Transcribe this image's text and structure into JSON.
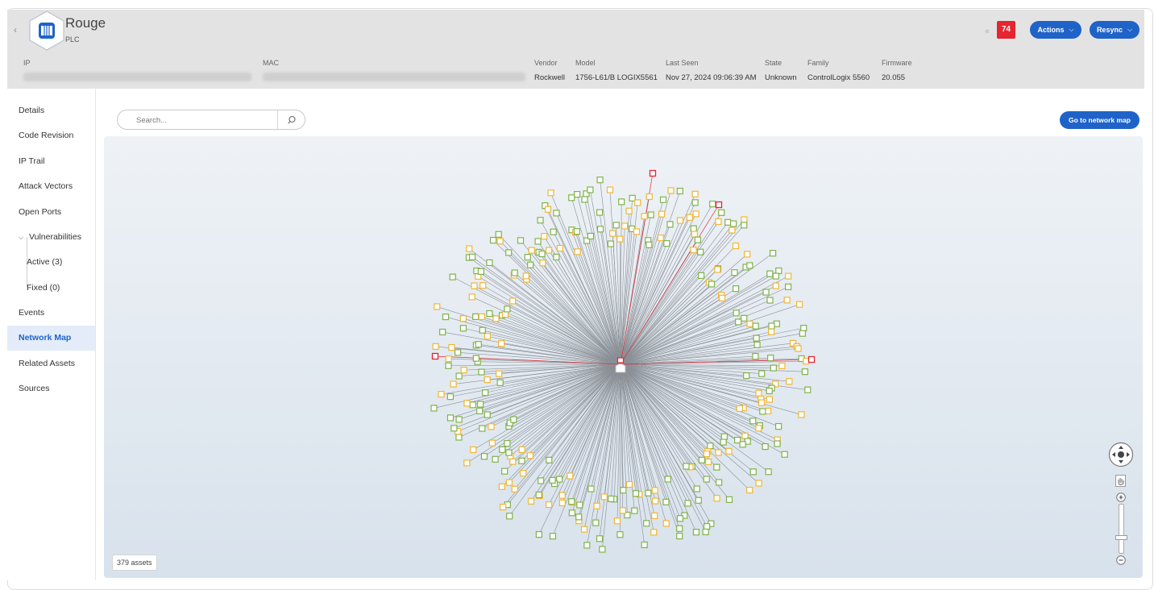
{
  "header": {
    "asset_name": "Rouge",
    "asset_type": "PLC",
    "icons": {
      "back": "chevron-left-icon",
      "asset": "plc-icon",
      "collapse": "double-chevron-left-icon"
    },
    "risk_score": "74",
    "risk_color": "#e5252f",
    "actions_label": "Actions",
    "resync_label": "Resync",
    "accent_color": "#1f63c9"
  },
  "meta": {
    "ip_label": "IP",
    "mac_label": "MAC",
    "vendor_label": "Vendor",
    "vendor_value": "Rockwell",
    "model_label": "Model",
    "model_value": "1756-L61/B LOGIX5561",
    "last_seen_label": "Last Seen",
    "last_seen_value": "Nov 27, 2024 09:06:39 AM",
    "state_label": "State",
    "state_value": "Unknown",
    "family_label": "Family",
    "family_value": "ControlLogix 5560",
    "firmware_label": "Firmware",
    "firmware_value": "20.055"
  },
  "sidebar": {
    "items": [
      {
        "label": "Details"
      },
      {
        "label": "Code Revision"
      },
      {
        "label": "IP Trail"
      },
      {
        "label": "Attack Vectors"
      },
      {
        "label": "Open Ports"
      },
      {
        "label": "Vulnerabilities",
        "expanded": true
      },
      {
        "label": "Active (3)"
      },
      {
        "label": "Fixed (0)"
      },
      {
        "label": "Events"
      },
      {
        "label": "Network Map",
        "active": true
      },
      {
        "label": "Related Assets"
      },
      {
        "label": "Sources"
      }
    ]
  },
  "main": {
    "search_placeholder": "Search...",
    "goto_label": "Go to network map",
    "asset_count": "379 assets",
    "map_icons": [
      "compass-pan-icon",
      "hand-icon",
      "zoom-in-icon",
      "zoom-out-icon"
    ],
    "node_colors": {
      "normal": "#7fb24a",
      "warning": "#f2b632",
      "critical": "#e5252f",
      "edge": "#8a8f96"
    }
  }
}
